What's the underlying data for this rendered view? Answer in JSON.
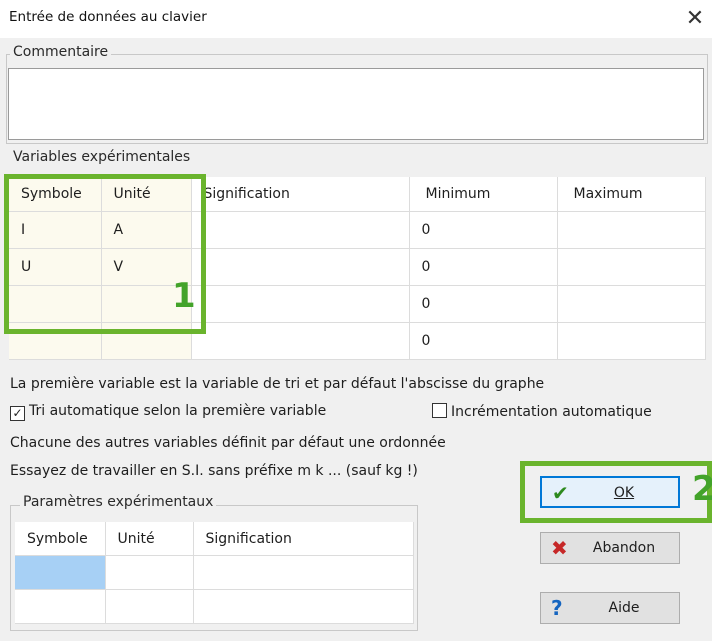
{
  "window": {
    "title": "Entrée de données au clavier",
    "close_symbol": "✕"
  },
  "comment": {
    "legend": "Commentaire",
    "value": ""
  },
  "variables": {
    "legend": "Variables expérimentales",
    "columns": [
      "Symbole",
      "Unité",
      "Signification",
      "Minimum",
      "Maximum"
    ],
    "rows": [
      {
        "symbol": "I",
        "unit": "A",
        "meaning": "",
        "min": "0",
        "max": ""
      },
      {
        "symbol": "U",
        "unit": "V",
        "meaning": "",
        "min": "0",
        "max": ""
      },
      {
        "symbol": "",
        "unit": "",
        "meaning": "",
        "min": "0",
        "max": ""
      },
      {
        "symbol": "",
        "unit": "",
        "meaning": "",
        "min": "0",
        "max": ""
      }
    ]
  },
  "info": {
    "line1": "La première variable est la variable de tri et par défaut l'abscisse du graphe",
    "tri_auto": {
      "label": "Tri automatique selon la première variable",
      "checked": true
    },
    "incr_auto": {
      "label": "Incrémentation automatique",
      "checked": false
    },
    "line3": "Chacune des autres variables définit par défaut une ordonnée",
    "line4": "Essayez de travailler en S.I. sans préfixe m k ... (sauf kg !)"
  },
  "parameters": {
    "legend": "Paramètres expérimentaux",
    "columns": [
      "Symbole",
      "Unité",
      "Signification"
    ],
    "rows": [
      {
        "symbol": "",
        "unit": "",
        "meaning": ""
      },
      {
        "symbol": "",
        "unit": "",
        "meaning": ""
      }
    ]
  },
  "buttons": {
    "ok": {
      "label": "OK",
      "icon": "checkmark-icon"
    },
    "abandon": {
      "label": "Abandon",
      "icon": "x-icon"
    },
    "aide": {
      "label": "Aide",
      "icon": "question-icon"
    }
  },
  "annotations": {
    "badge1": "1",
    "badge2": "2",
    "highlight_color": "#6ab42d"
  },
  "colors": {
    "selection": "#a7d0f5",
    "default_button_border": "#0078d7"
  }
}
